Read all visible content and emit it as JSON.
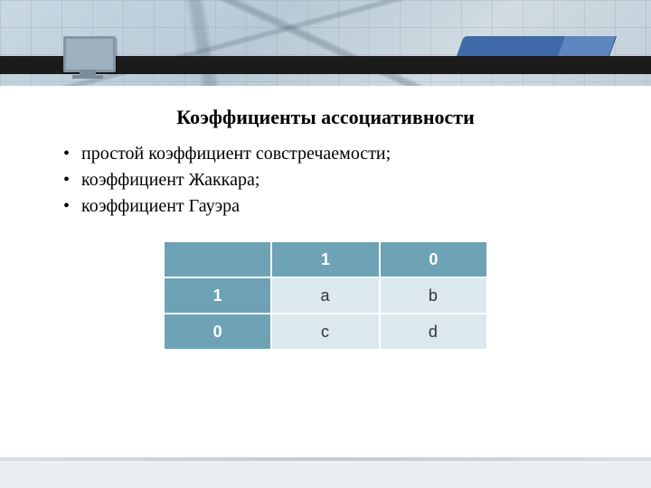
{
  "title": "Коэффициенты ассоциативности",
  "bullets": [
    "простой коэффициент совстречаемости;",
    "коэффициент Жаккара;",
    "коэффициент Гауэра"
  ],
  "table": {
    "col_headers": [
      "1",
      "0"
    ],
    "row_headers": [
      "1",
      "0"
    ],
    "cells": [
      [
        "a",
        "b"
      ],
      [
        "c",
        "d"
      ]
    ]
  },
  "colors": {
    "table_header": "#6ea2b5",
    "table_cell": "#dbe8ee",
    "accent_blue": "#3f6aa7"
  }
}
